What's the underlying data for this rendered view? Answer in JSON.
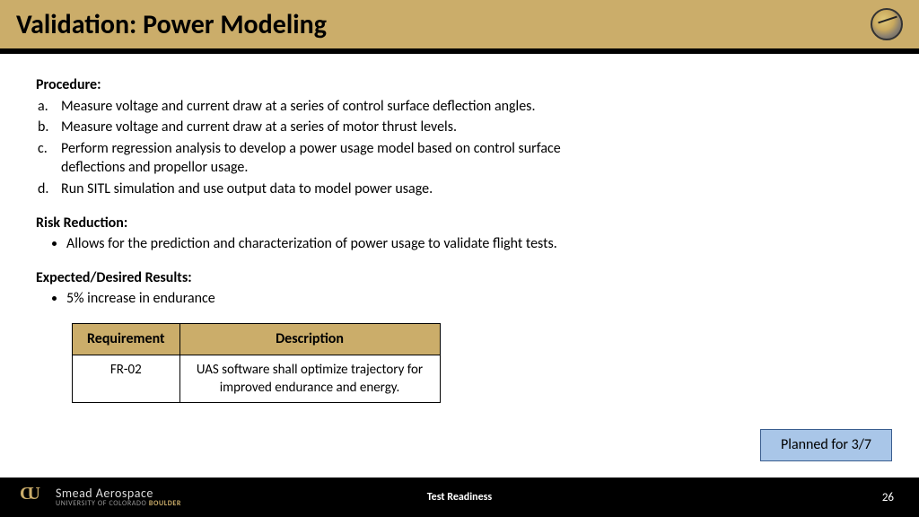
{
  "title": "Validation: Power Modeling",
  "procedure": {
    "heading": "Procedure:",
    "items": [
      {
        "marker": "a.",
        "text": "Measure voltage and current draw at a series of control surface deflection angles."
      },
      {
        "marker": "b.",
        "text": "Measure voltage and current draw at a series of motor thrust levels."
      },
      {
        "marker": "c.",
        "text": "Perform regression analysis to develop a power usage model based on control surface deflections and propellor usage."
      },
      {
        "marker": "d.",
        "text": "Run SITL simulation and use output data to model power usage."
      }
    ]
  },
  "risk": {
    "heading": "Risk Reduction:",
    "items": [
      "Allows for the prediction and characterization of power usage to validate flight tests."
    ]
  },
  "expected": {
    "heading": "Expected/Desired Results:",
    "items": [
      "5% increase in endurance"
    ]
  },
  "table": {
    "headers": {
      "req": "Requirement",
      "desc": "Description"
    },
    "rows": [
      {
        "req": "FR-02",
        "desc": "UAS software shall optimize trajectory for improved endurance and energy."
      }
    ]
  },
  "planned": "Planned for 3/7",
  "footer": {
    "org1": "Smead Aerospace",
    "org2a": "UNIVERSITY OF COLORADO ",
    "org2b": "BOULDER",
    "center": "Test Readiness",
    "page": "26"
  }
}
